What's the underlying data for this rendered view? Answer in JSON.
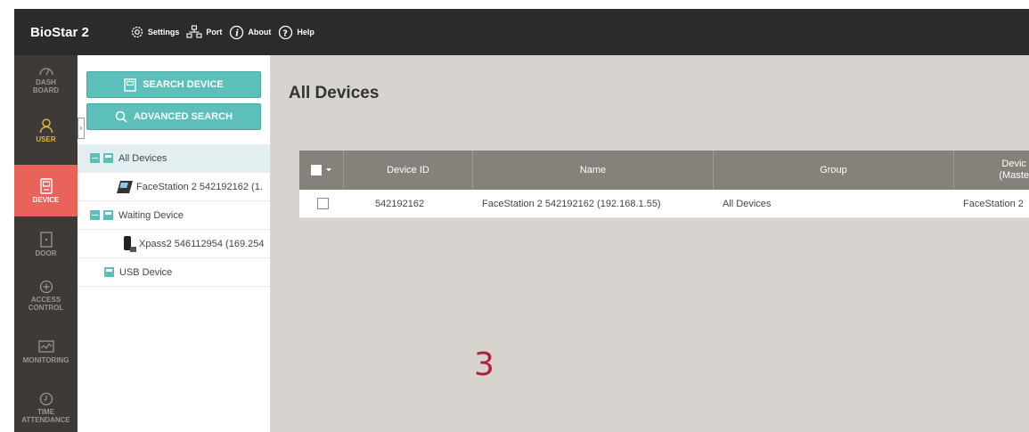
{
  "app": {
    "brand": "BioStar 2"
  },
  "topnav": [
    {
      "label": "Settings",
      "icon": "gear-icon"
    },
    {
      "label": "Port",
      "icon": "network-icon"
    },
    {
      "label": "About",
      "icon": "info-icon"
    },
    {
      "label": "Help",
      "icon": "help-icon"
    }
  ],
  "leftnav": [
    {
      "label": "DASH\nBOARD",
      "icon": "speedometer-icon"
    },
    {
      "label": "USER",
      "icon": "user-icon"
    },
    {
      "label": "DEVICE",
      "icon": "device-icon"
    },
    {
      "label": "DOOR",
      "icon": "door-icon"
    },
    {
      "label": "ACCESS\nCONTROL",
      "icon": "access-control-icon"
    },
    {
      "label": "MONITORING",
      "icon": "monitoring-icon"
    },
    {
      "label": "TIME\nATTENDANCE",
      "icon": "clock-icon"
    }
  ],
  "tree": {
    "search_device_label": "SEARCH DEVICE",
    "advanced_search_label": "ADVANCED SEARCH",
    "collapse_glyph": "›",
    "items": [
      {
        "label": "All Devices"
      },
      {
        "label": "FaceStation 2 542192162 (1."
      },
      {
        "label": "Waiting Device"
      },
      {
        "label": "Xpass2 546112954 (169.254"
      },
      {
        "label": "USB Device"
      }
    ]
  },
  "main": {
    "title": "All Devices",
    "columns": [
      "Device ID",
      "Name",
      "Group",
      "Devic\n(Maste"
    ],
    "rows": [
      {
        "device_id": "542192162",
        "name": "FaceStation 2 542192162 (192.168.1.55)",
        "group": "All Devices",
        "device_type": "FaceStation 2"
      }
    ],
    "annotation": "3"
  },
  "colors": {
    "topbar": "#2b2b2b",
    "leftnav": "#3d3a38",
    "active_nav": "#e9635a",
    "user_accent": "#e2b53a",
    "teal": "#5cbfb9",
    "main_bg": "#d7d3ce",
    "table_header": "#87817b",
    "annotation": "#b0203a"
  }
}
